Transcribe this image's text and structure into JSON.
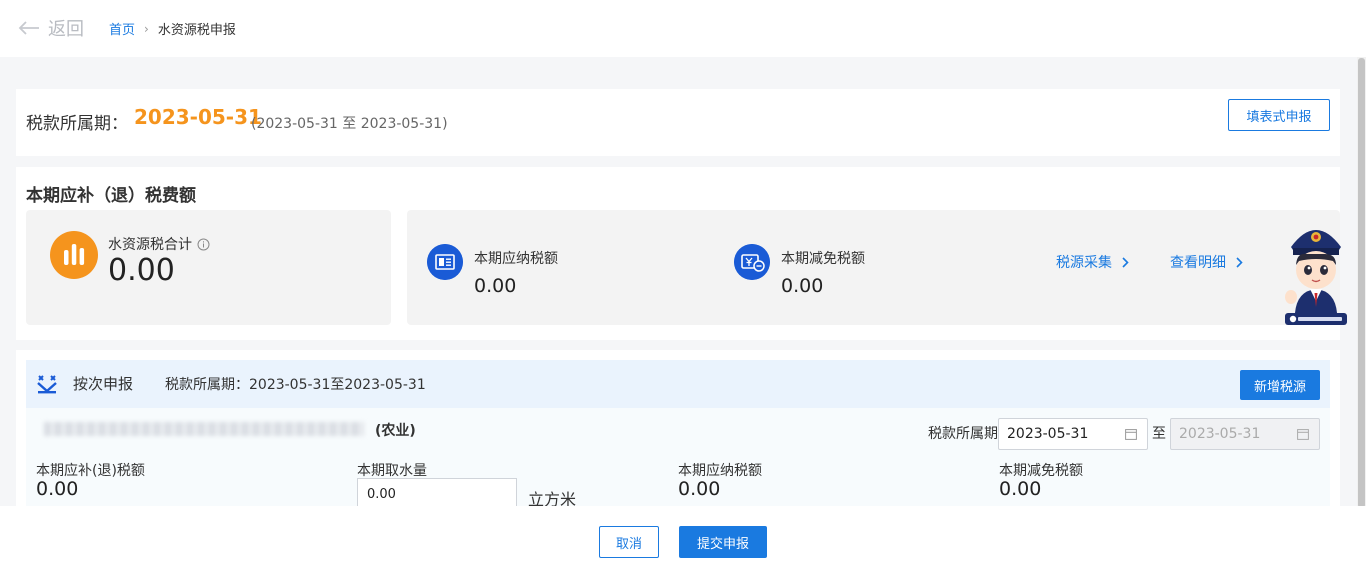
{
  "nav": {
    "back_label": "返回",
    "breadcrumb_home": "首页",
    "breadcrumb_sep": "›",
    "breadcrumb_current": "水资源税申报"
  },
  "period": {
    "label": "税款所属期：",
    "date": "2023-05-31",
    "range": "(2023-05-31 至 2023-05-31)",
    "form_button": "填表式申报"
  },
  "summary": {
    "title": "本期应补（退）税费额",
    "total_label": "水资源税合计",
    "total_value": "0.00",
    "payable_label": "本期应纳税额",
    "payable_value": "0.00",
    "relief_label": "本期减免税额",
    "relief_value": "0.00",
    "link_collect": "税源采集",
    "link_detail": "查看明细"
  },
  "detail": {
    "mode": "按次申报",
    "period_text": "税款所属期：2023-05-31至2023-05-31",
    "add_button": "新增税源",
    "industry": "(农业)",
    "date_label": "税款所属期",
    "date_from": "2023-05-31",
    "date_sep": "至",
    "date_to": "2023-05-31",
    "f1_label": "本期应补(退)税额",
    "f1_value": "0.00",
    "f2_label": "本期取水量",
    "f2_value": "0.00",
    "f2_unit": "立方米",
    "f3_label": "本期应纳税额",
    "f3_value": "0.00",
    "f4_label": "本期减免税额",
    "f4_value": "0.00"
  },
  "footer": {
    "cancel": "取消",
    "submit": "提交申报"
  },
  "colors": {
    "accent": "#1a7ae0",
    "orange": "#f5941d",
    "icon_blue": "#1a5bd6"
  }
}
